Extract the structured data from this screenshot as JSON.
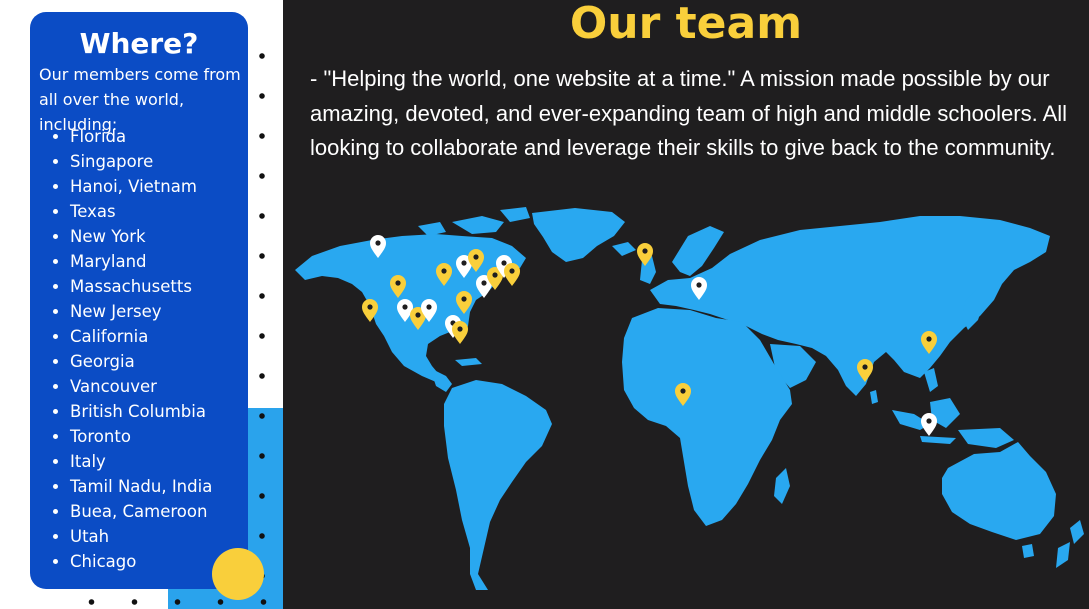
{
  "sidebar": {
    "heading": "Where?",
    "intro": "Our members come from all over the world, including:",
    "locations": [
      "Florida",
      "Singapore",
      "Hanoi, Vietnam",
      "Texas",
      "New York",
      "Maryland",
      "Massachusetts",
      "New Jersey",
      "California",
      "Georgia",
      "Vancouver",
      "British Columbia",
      "Toronto",
      "Italy",
      "Tamil Nadu, India",
      "Buea, Cameroon",
      "Utah",
      "Chicago"
    ]
  },
  "main": {
    "title": "Our team",
    "mission": " - \"Helping the world, one website at a time.\" A mission made possible by our amazing, devoted, and ever-expanding team of high and middle schoolers. All looking to collaborate and leverage their skills to give back to the community."
  },
  "colors": {
    "background": "#1f1e1f",
    "card_blue": "#0b4cc5",
    "accent_yellow": "#f9cf3b",
    "map_blue": "#29a8f0",
    "pin_white": "#ffffff"
  },
  "map": {
    "pin_icon": "map-pin-icon",
    "pin_count": 26
  }
}
